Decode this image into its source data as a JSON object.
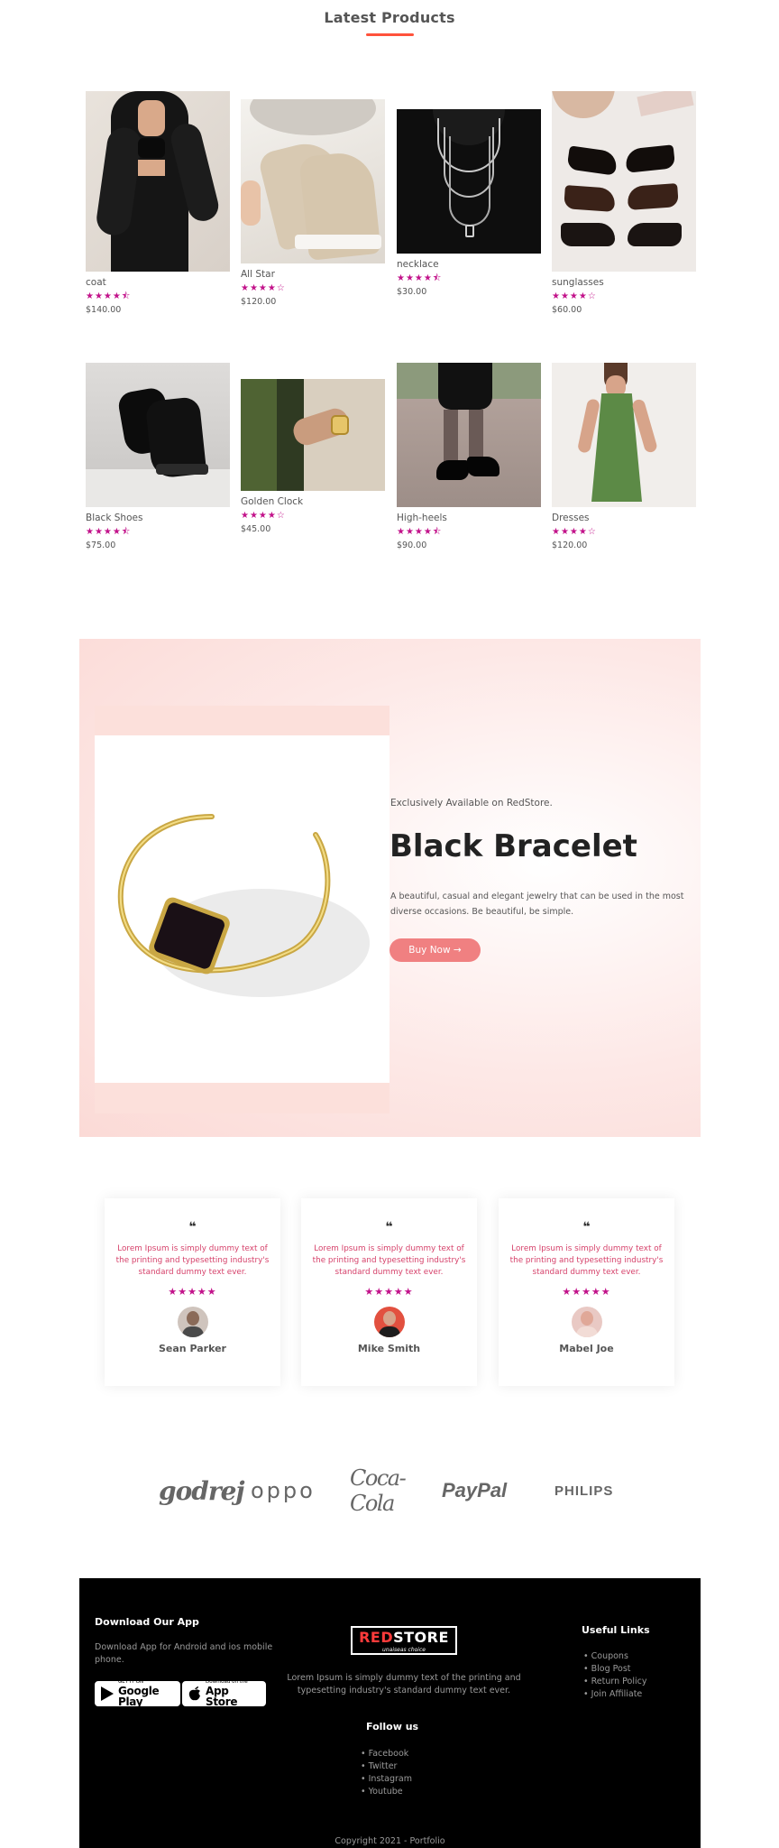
{
  "latest": {
    "title": "Latest Products",
    "products": [
      {
        "name": "coat",
        "stars": "★★★★⯪",
        "price": "$140.00"
      },
      {
        "name": "All Star",
        "stars": "★★★★☆",
        "price": "$120.00"
      },
      {
        "name": "necklace",
        "stars": "★★★★⯪",
        "price": "$30.00"
      },
      {
        "name": "sunglasses",
        "stars": "★★★★☆",
        "price": "$60.00"
      },
      {
        "name": "Black Shoes",
        "stars": "★★★★⯪",
        "price": "$75.00"
      },
      {
        "name": "Golden Clock",
        "stars": "★★★★☆",
        "price": "$45.00"
      },
      {
        "name": "High-heels",
        "stars": "★★★★⯪",
        "price": "$90.00"
      },
      {
        "name": "Dresses",
        "stars": "★★★★☆",
        "price": "$120.00"
      }
    ]
  },
  "offer": {
    "small_text": "Exclusively Available on RedStore.",
    "title": "Black Bracelet",
    "description": "A beautiful, casual and elegant jewelry that can be used in the most diverse occasions. Be beautiful, be simple.",
    "button": "Buy Now →"
  },
  "testimonials": [
    {
      "quote_mark": "❝",
      "text": "Lorem Ipsum is simply dummy text of the printing and typesetting industry's standard dummy text ever.",
      "stars": "★★★★★",
      "name": "Sean Parker"
    },
    {
      "quote_mark": "❝",
      "text": "Lorem Ipsum is simply dummy text of the printing and typesetting industry's standard dummy text ever.",
      "stars": "★★★★★",
      "name": "Mike Smith"
    },
    {
      "quote_mark": "❝",
      "text": "Lorem Ipsum is simply dummy text of the printing and typesetting industry's standard dummy text ever.",
      "stars": "★★★★★",
      "name": "Mabel Joe"
    }
  ],
  "brands": [
    "godrej",
    "oppo",
    "Coca-Cola",
    "PayPal",
    "PHILIPS"
  ],
  "footer": {
    "download_title": "Download Our App",
    "download_text": "Download App for Android and ios mobile phone.",
    "google_play_small": "GET IT ON",
    "google_play": "Google Play",
    "app_store_small": "Download on the",
    "app_store": "App Store",
    "logo_red": "RED",
    "logo_white": "STORE",
    "logo_tagline": "unaiseas choice",
    "about": "Lorem Ipsum is simply dummy text of the printing and typesetting industry's standard dummy text ever.",
    "useful_title": "Useful Links",
    "useful_links": [
      "Coupons",
      "Blog Post",
      "Return Policy",
      "Join Affiliate"
    ],
    "follow_title": "Follow us",
    "follow_links": [
      "Facebook",
      "Twitter",
      "Instagram",
      "Youtube"
    ],
    "copyright": "Copyright 2021 - Portfolio"
  },
  "colors": {
    "accent": "#ff523b",
    "star": "#c2128a",
    "button": "#f08081",
    "testimonial_text": "#d6426b",
    "footer_bg": "#000000"
  }
}
